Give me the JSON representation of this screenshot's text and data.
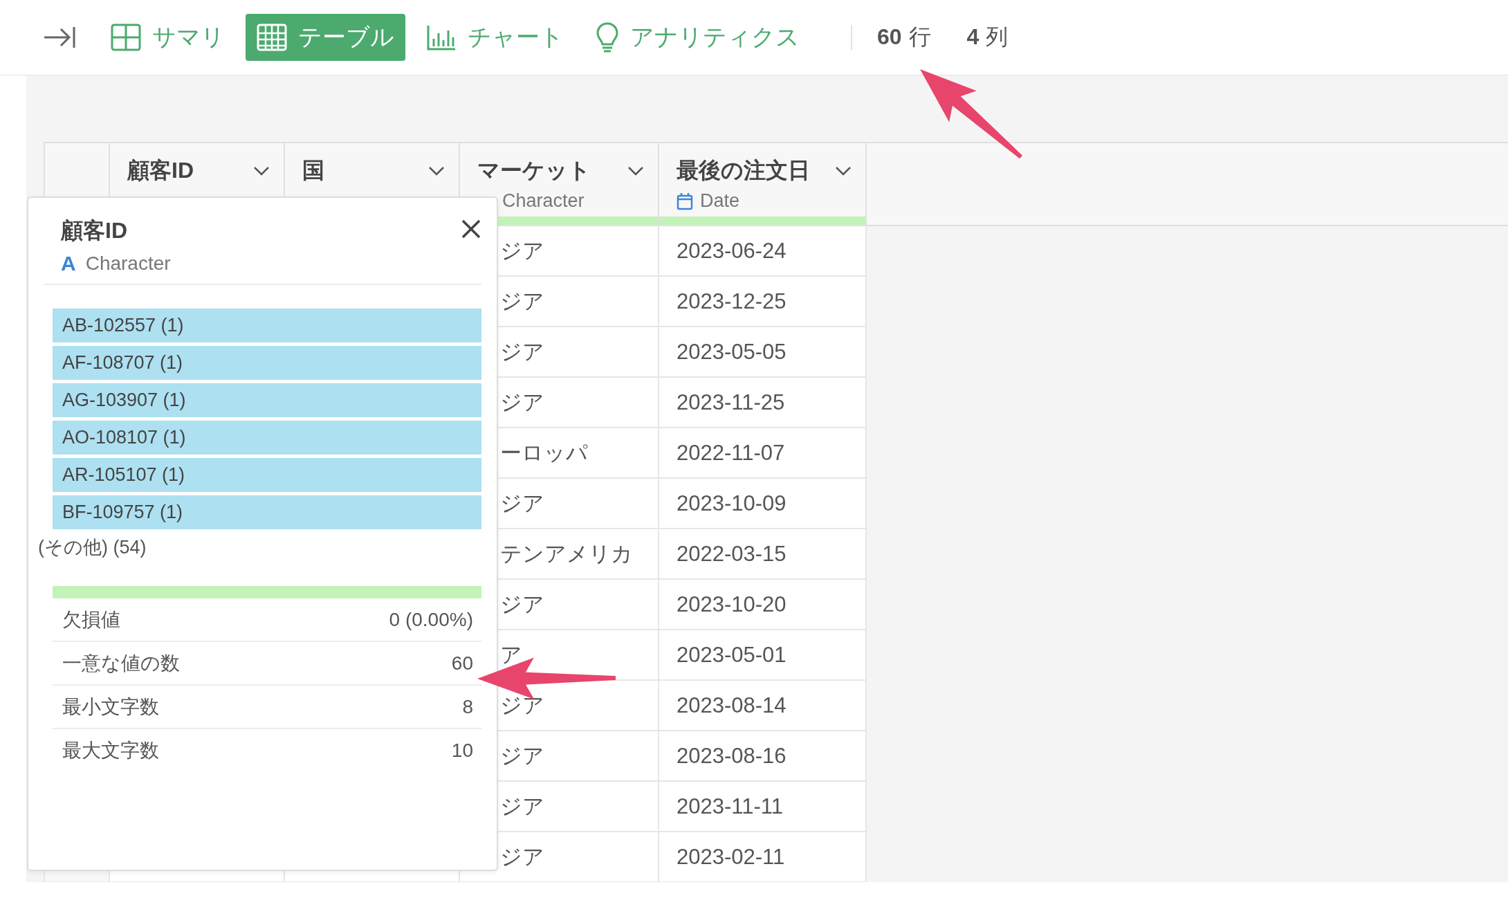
{
  "toolbar": {
    "tabs": [
      {
        "label": "サマリ",
        "kind": "summary",
        "selected": false
      },
      {
        "label": "テーブル",
        "kind": "table",
        "selected": true
      },
      {
        "label": "チャート",
        "kind": "chart",
        "selected": false
      },
      {
        "label": "アナリティクス",
        "kind": "analytics",
        "selected": false
      }
    ],
    "counts": [
      {
        "number": "60",
        "unit": "行"
      },
      {
        "number": "4",
        "unit": "列"
      }
    ]
  },
  "table": {
    "columns": [
      {
        "name": "顧客ID"
      },
      {
        "name": "国"
      },
      {
        "name": "マーケット",
        "type": {
          "kind": "character",
          "label": "Character"
        },
        "level": 1
      },
      {
        "name": "最後の注文日",
        "type": {
          "kind": "date",
          "label": "Date"
        },
        "level": 1
      }
    ],
    "rows": [
      {
        "market": "ジア",
        "date": "2023-06-24"
      },
      {
        "market": "ジア",
        "date": "2023-12-25"
      },
      {
        "market": "ジア",
        "date": "2023-05-05"
      },
      {
        "market": "ジア",
        "date": "2023-11-25"
      },
      {
        "market": "ーロッパ",
        "date": "2022-11-07"
      },
      {
        "market": "ジア",
        "date": "2023-10-09"
      },
      {
        "market": "テンアメリカ",
        "date": "2022-03-15"
      },
      {
        "market": "ジア",
        "date": "2023-10-20"
      },
      {
        "market": "ア",
        "date": "2023-05-01"
      },
      {
        "market": "ジア",
        "date": "2023-08-14"
      },
      {
        "market": "ジア",
        "date": "2023-08-16"
      },
      {
        "market": "ジア",
        "date": "2023-11-11"
      },
      {
        "market": "ジア",
        "date": "2023-02-11"
      }
    ]
  },
  "popup": {
    "title": "顧客ID",
    "type": {
      "kind": "character",
      "mark": "A",
      "label": "Character"
    },
    "values": [
      {
        "label": "AB-102557 (1)"
      },
      {
        "label": "AF-108707 (1)"
      },
      {
        "label": "AG-103907 (1)"
      },
      {
        "label": "AO-108107 (1)"
      },
      {
        "label": "AR-105107 (1)"
      },
      {
        "label": "BF-109757 (1)"
      }
    ],
    "other": "(その他) (54)",
    "quality": {
      "level": 1
    },
    "stats": [
      {
        "label": "欠損値",
        "value": "0 (0.00%)"
      },
      {
        "label": "一意な値の数",
        "value": "60"
      },
      {
        "label": "最小文字数",
        "value": "8"
      },
      {
        "label": "最大文字数",
        "value": "10"
      }
    ]
  }
}
